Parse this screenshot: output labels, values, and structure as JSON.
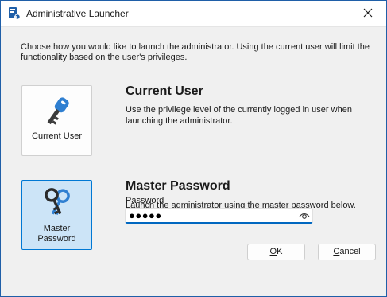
{
  "window": {
    "title": "Administrative Launcher"
  },
  "intro": "Choose how you would like to launch the administrator. Using the current user will limit the functionality based on the user's privileges.",
  "current_user": {
    "button_label": "Current User",
    "heading": "Current User",
    "description": "Use the privilege level of the currently logged in user when launching the administrator."
  },
  "master_password": {
    "button_label_line1": "Master",
    "button_label_line2": "Password",
    "heading": "Master Password",
    "description": "Launch the administrator using the master password below.",
    "field_label": "Password",
    "field_value": "●●●●●"
  },
  "buttons": {
    "ok_access_key": "O",
    "ok_rest": "K",
    "cancel_access_key": "C",
    "cancel_rest": "ancel"
  },
  "colors": {
    "accent": "#0078d4",
    "selected_bg": "#cce4f7",
    "key_blue": "#2f7fd1",
    "dialog_bg": "#f0f0f0"
  },
  "icons": {
    "app": "launcher-app-icon",
    "close": "close-icon",
    "current_user": "key-icon",
    "master_password": "keys-icon",
    "reveal": "eye-icon"
  }
}
